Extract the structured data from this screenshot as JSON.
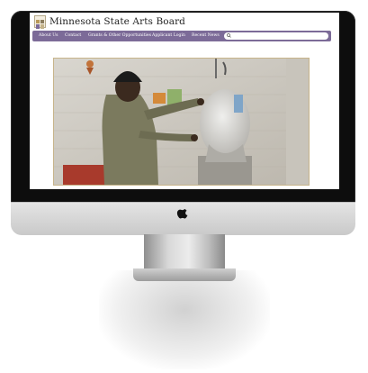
{
  "site": {
    "title": "Minnesota State Arts Board",
    "logo": "msab-logo-icon",
    "nav": [
      {
        "label": "About Us"
      },
      {
        "label": "Contact"
      },
      {
        "label": "Grants & Other Opportunities"
      },
      {
        "label": "Applicant Login"
      },
      {
        "label": "Recent News"
      }
    ],
    "search": {
      "placeholder": "",
      "icon": "search-icon"
    },
    "nav_color": "#7c6b98"
  },
  "hero": {
    "image": "artist-sculpting-clay-head-photo"
  },
  "device": {
    "brand_icon": "apple-icon"
  }
}
